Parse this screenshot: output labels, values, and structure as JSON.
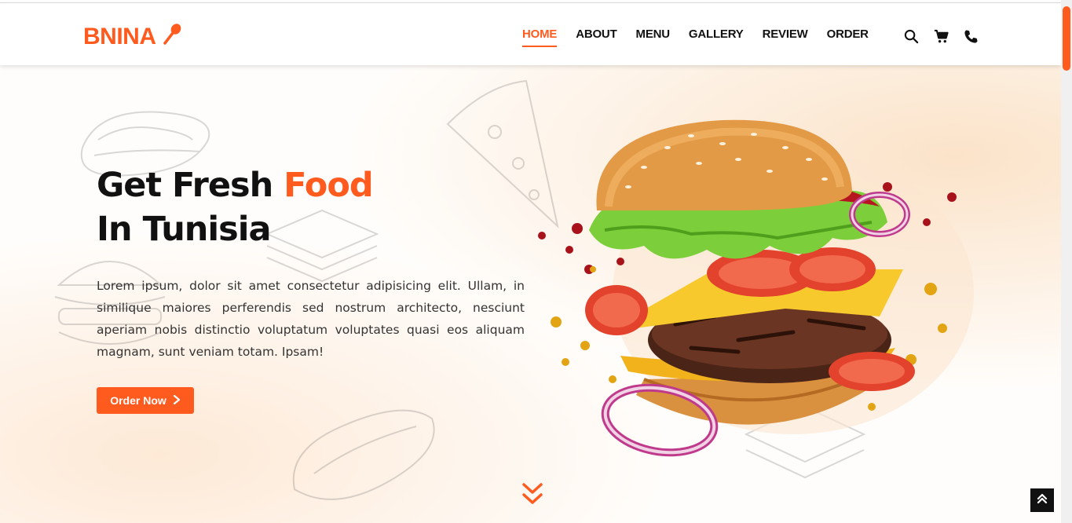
{
  "brand": {
    "name": "BNINA",
    "icon": "spoon-icon",
    "color": "#ff5b1f"
  },
  "nav": {
    "items": [
      {
        "label": "HOME",
        "active": true
      },
      {
        "label": "ABOUT",
        "active": false
      },
      {
        "label": "MENU",
        "active": false
      },
      {
        "label": "GALLERY",
        "active": false
      },
      {
        "label": "REVIEW",
        "active": false
      },
      {
        "label": "ORDER",
        "active": false
      }
    ],
    "icons": [
      "search-icon",
      "cart-icon",
      "phone-icon"
    ]
  },
  "hero": {
    "title_part1": "Get Fresh ",
    "title_accent": "Food",
    "title_line2": "In Tunisia",
    "paragraph": "Lorem ipsum, dolor sit amet consectetur adipisicing elit. Ullam, in similique maiores perferendis sed nostrum architecto, nesciunt aperiam nobis distinctio voluptatum voluptates quasi eos aliquam magnam, sunt veniam totam. Ipsam!",
    "cta_label": "Order Now",
    "image": "burger-image"
  },
  "colors": {
    "accent": "#ff5b1f",
    "text": "#111111"
  }
}
